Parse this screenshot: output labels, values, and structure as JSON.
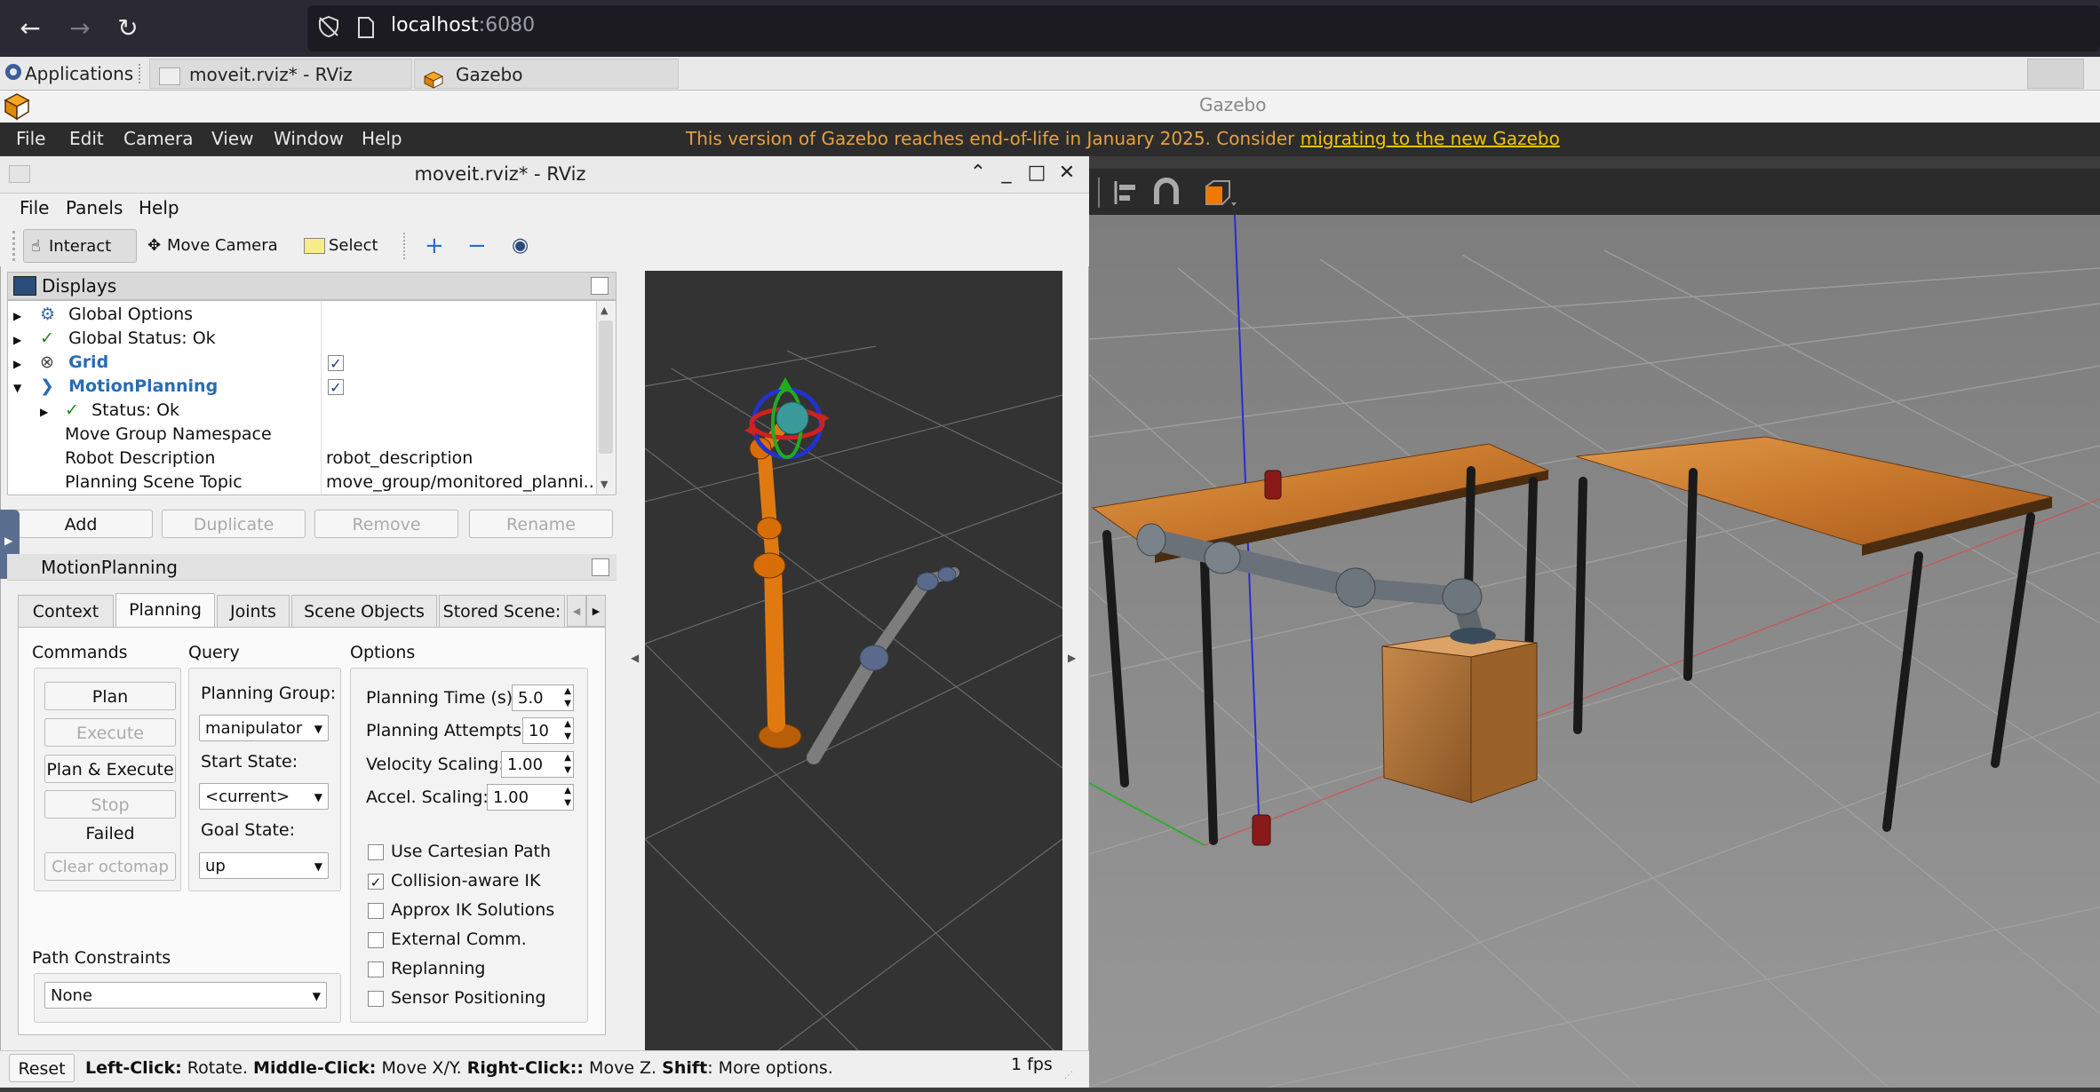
{
  "browser": {
    "url_host": "localhost",
    "url_port": ":6080"
  },
  "taskbar": {
    "apps_label": "Applications",
    "task_rviz": "moveit.rviz* - RViz",
    "task_gazebo": "Gazebo"
  },
  "gazebo": {
    "title": "Gazebo",
    "menu": [
      "File",
      "Edit",
      "Camera",
      "View",
      "Window",
      "Help"
    ],
    "eol_text": "This version of Gazebo reaches end-of-life in January 2025. Consider ",
    "eol_link": "migrating to the new Gazebo"
  },
  "rviz": {
    "title": "moveit.rviz* - RViz",
    "menu": [
      "File",
      "Panels",
      "Help"
    ],
    "tools": {
      "interact": "Interact",
      "move_camera": "Move Camera",
      "select": "Select"
    },
    "displays": {
      "header": "Displays",
      "rows": {
        "global_options": "Global Options",
        "global_status": "Global Status: Ok",
        "grid": "Grid",
        "motion_planning": "MotionPlanning",
        "status": "Status: Ok",
        "move_group_namespace": "Move Group Namespace",
        "robot_description_label": "Robot Description",
        "robot_description_value": "robot_description",
        "planning_scene_topic_label": "Planning Scene Topic",
        "planning_scene_topic_value": "move_group/monitored_planni..."
      },
      "buttons": {
        "add": "Add",
        "duplicate": "Duplicate",
        "remove": "Remove",
        "rename": "Rename"
      }
    },
    "motion_planning_panel": {
      "header": "MotionPlanning",
      "tabs": [
        "Context",
        "Planning",
        "Joints",
        "Scene Objects",
        "Stored Scene:"
      ],
      "commands": {
        "title": "Commands",
        "plan": "Plan",
        "execute": "Execute",
        "plan_execute": "Plan & Execute",
        "stop": "Stop",
        "result": "Failed",
        "clear_octomap": "Clear octomap"
      },
      "query": {
        "title": "Query",
        "planning_group_label": "Planning Group:",
        "planning_group_value": "manipulator",
        "start_state_label": "Start State:",
        "start_state_value": "<current>",
        "goal_state_label": "Goal State:",
        "goal_state_value": "up"
      },
      "options": {
        "title": "Options",
        "planning_time_label": "Planning Time (s):",
        "planning_time_value": "5.0",
        "planning_attempts_label": "Planning Attempts:",
        "planning_attempts_value": "10",
        "velocity_scaling_label": "Velocity Scaling:",
        "velocity_scaling_value": "1.00",
        "accel_scaling_label": "Accel. Scaling:",
        "accel_scaling_value": "1.00",
        "use_cartesian_path": "Use Cartesian Path",
        "collision_aware_ik": "Collision-aware IK",
        "approx_ik": "Approx IK Solutions",
        "external_comm": "External Comm.",
        "replanning": "Replanning",
        "sensor_positioning": "Sensor Positioning"
      },
      "path_constraints": {
        "title": "Path Constraints",
        "value": "None"
      }
    },
    "statusbar": {
      "reset": "Reset",
      "left_click": "Left-Click:",
      "rotate": " Rotate. ",
      "middle_click": "Middle-Click:",
      "move_xy": " Move X/Y. ",
      "right_click": "Right-Click::",
      "move_z": " Move Z. ",
      "shift": "Shift",
      "more": ": More options.",
      "fps": "1 fps"
    }
  },
  "colors": {
    "gazebo_bg": "#8a8a8a",
    "rviz_view_bg": "#333333",
    "robot_orange": "#e07a10",
    "eol_orange": "#e6a040",
    "link_yellow": "#f2c500"
  }
}
